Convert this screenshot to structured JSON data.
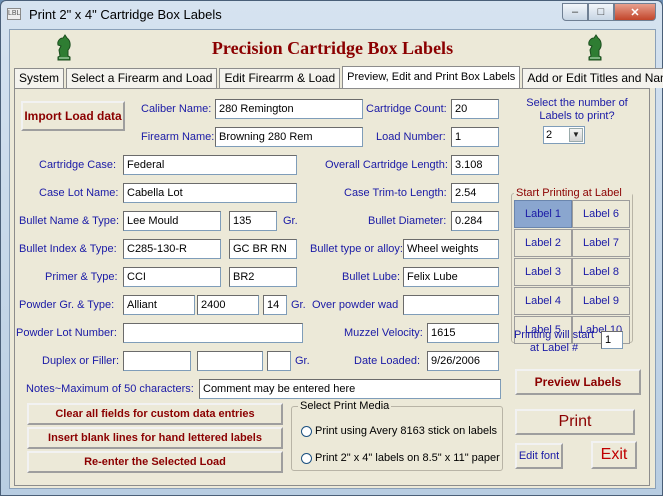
{
  "window": {
    "title": "Print 2\" x 4\" Cartridge Box Labels",
    "icon_text": "LBL"
  },
  "header": {
    "title": "Precision Cartridge Box Labels"
  },
  "tabs": [
    {
      "label": "System"
    },
    {
      "label": "Select a Firearm and Load"
    },
    {
      "label": "Edit Firearrm & Load"
    },
    {
      "label": "Preview, Edit and Print Box Labels"
    },
    {
      "label": "Add or Edit Titles and Names"
    }
  ],
  "import_button": "Import Load data",
  "fields": {
    "caliber_name": {
      "label": "Caliber Name:",
      "value": "280 Remington"
    },
    "cartridge_count": {
      "label": "Cartridge Count:",
      "value": "20"
    },
    "firearm_name": {
      "label": "Firearm Name:",
      "value": "Browning 280 Rem"
    },
    "load_number": {
      "label": "Load Number:",
      "value": "1"
    },
    "cartridge_case": {
      "label": "Cartridge Case:",
      "value": "Federal"
    },
    "overall_length": {
      "label": "Overall Cartridge Length:",
      "value": "3.108"
    },
    "case_lot": {
      "label": "Case Lot Name:",
      "value": "Cabella Lot"
    },
    "case_trim": {
      "label": "Case Trim-to Length:",
      "value": "2.54"
    },
    "bullet_name": {
      "label": "Bullet Name & Type:",
      "value1": "Lee Mould",
      "value2": "135",
      "unit": "Gr."
    },
    "bullet_diameter": {
      "label": "Bullet Diameter:",
      "value": "0.284"
    },
    "bullet_index": {
      "label": "Bullet Index & Type:",
      "value1": "C285-130-R",
      "value2": "GC BR RN"
    },
    "bullet_alloy": {
      "label": "Bullet type or alloy:",
      "value": "Wheel weights"
    },
    "primer": {
      "label": "Primer & Type:",
      "value1": "CCI",
      "value2": "BR2"
    },
    "bullet_lube": {
      "label": "Bullet Lube:",
      "value": "Felix Lube"
    },
    "powder": {
      "label": "Powder Gr. & Type:",
      "value1": "Alliant",
      "value2": "2400",
      "value3": "14",
      "unit": "Gr."
    },
    "over_powder_wad": {
      "label": "Over powder wad",
      "value": ""
    },
    "powder_lot": {
      "label": "Powder Lot Number:",
      "value": ""
    },
    "muzzle_velocity": {
      "label": "Muzzel Velocity:",
      "value": "1615"
    },
    "duplex": {
      "label": "Duplex or Filler:",
      "value1": "",
      "value2": "",
      "value3": "",
      "unit": "Gr."
    },
    "date_loaded": {
      "label": "Date Loaded:",
      "value": "9/26/2006"
    },
    "notes": {
      "label": "Notes~Maximum of 50 characters:",
      "value": "Comment may be entered here"
    }
  },
  "labels_to_print": {
    "label": "Select the number of Labels to print?",
    "value": "2"
  },
  "start_printing": {
    "title": "Start Printing at Label #",
    "cells": [
      "Label 1",
      "Label 6",
      "Label 2",
      "Label 7",
      "Label 3",
      "Label 8",
      "Label 4",
      "Label 9",
      "Label 5",
      "Label 10"
    ],
    "will_start_label": "Printing will start at Label #",
    "will_start_value": "1"
  },
  "buttons": {
    "clear": "Clear all fields for custom data entries",
    "insert_blank": "Insert blank lines for hand lettered labels",
    "reenter": "Re-enter the Selected Load",
    "preview": "Preview Labels",
    "print": "Print",
    "edit_font": "Edit font",
    "exit": "Exit"
  },
  "print_media": {
    "title": "Select Print Media",
    "option1": "Print using Avery 8163 stick on labels",
    "option2": "Print 2\" x 4\" labels on 8.5\" x 11\" paper"
  }
}
